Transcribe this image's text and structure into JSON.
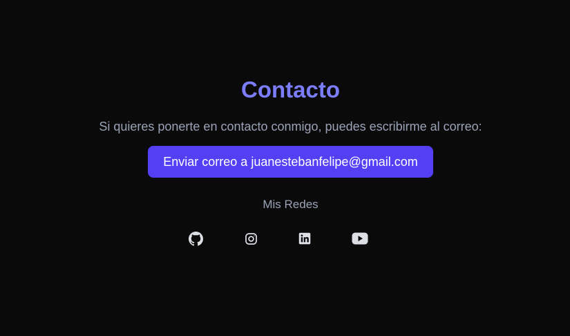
{
  "contact": {
    "title": "Contacto",
    "description": "Si quieres ponerte en contacto conmigo, puedes escribirme al correo:",
    "email_button_label": "Enviar correo a juanestebanfelipe@gmail.com",
    "socials_title": "Mis Redes"
  },
  "socials": [
    {
      "icon": "github-icon"
    },
    {
      "icon": "instagram-icon"
    },
    {
      "icon": "linkedin-icon"
    },
    {
      "icon": "youtube-icon"
    }
  ],
  "colors": {
    "background": "#0a0a0b",
    "title": "#7b7dfb",
    "muted_text": "#9aa3b6",
    "button": "#5340f5",
    "icon": "#dcdfe6"
  }
}
